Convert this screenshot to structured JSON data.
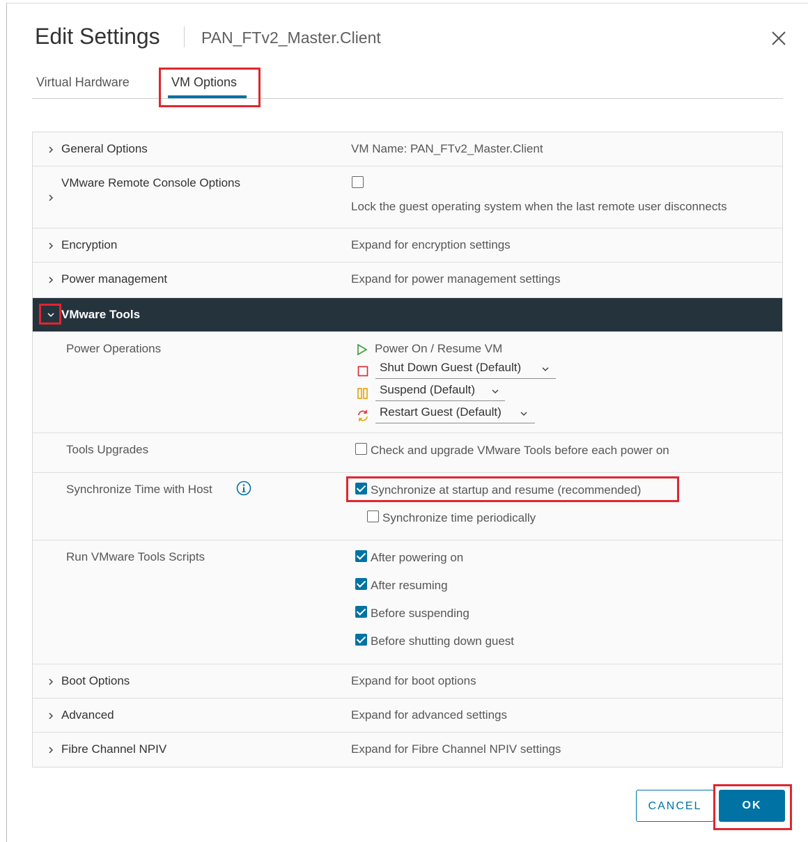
{
  "dialog": {
    "title": "Edit Settings",
    "subtitle": "PAN_FTv2_Master.Client"
  },
  "tabs": [
    {
      "label": "Virtual Hardware",
      "active": false
    },
    {
      "label": "VM Options",
      "active": true
    }
  ],
  "sections": {
    "general": {
      "label": "General Options",
      "value": "VM Name: PAN_FTv2_Master.Client"
    },
    "remote_console": {
      "label": "VMware Remote Console Options",
      "checkbox_label": "Lock the guest operating system when the last remote user disconnects",
      "checked": false
    },
    "encryption": {
      "label": "Encryption",
      "value": "Expand for encryption settings"
    },
    "power_mgmt": {
      "label": "Power management",
      "value": "Expand for power management settings"
    },
    "vmware_tools": {
      "label": "VMware Tools",
      "power_operations": {
        "label": "Power Operations",
        "power_on": "Power On / Resume VM",
        "shutdown": "Shut Down Guest (Default)",
        "suspend": "Suspend (Default)",
        "restart": "Restart Guest (Default)"
      },
      "tools_upgrades": {
        "label": "Tools Upgrades",
        "option": "Check and upgrade VMware Tools before each power on",
        "checked": false
      },
      "sync_time": {
        "label": "Synchronize Time with Host",
        "startup": "Synchronize at startup and resume (recommended)",
        "startup_checked": true,
        "periodic": "Synchronize time periodically",
        "periodic_checked": false
      },
      "scripts": {
        "label": "Run VMware Tools Scripts",
        "after_power_on": "After powering on",
        "after_resume": "After resuming",
        "before_suspend": "Before suspending",
        "before_shutdown": "Before shutting down guest"
      }
    },
    "boot": {
      "label": "Boot Options",
      "value": "Expand for boot options"
    },
    "advanced": {
      "label": "Advanced",
      "value": "Expand for advanced settings"
    },
    "fibre": {
      "label": "Fibre Channel NPIV",
      "value": "Expand for Fibre Channel NPIV settings"
    }
  },
  "buttons": {
    "cancel": "CANCEL",
    "ok": "OK"
  },
  "colors": {
    "accent": "#0072a3",
    "header_dark": "#25333d",
    "highlight": "#e0262e"
  },
  "icons": [
    "close-icon",
    "chevron-right-icon",
    "chevron-down-icon",
    "play-icon",
    "stop-icon",
    "pause-icon",
    "restart-icon",
    "info-icon",
    "dropdown-caret-icon"
  ]
}
